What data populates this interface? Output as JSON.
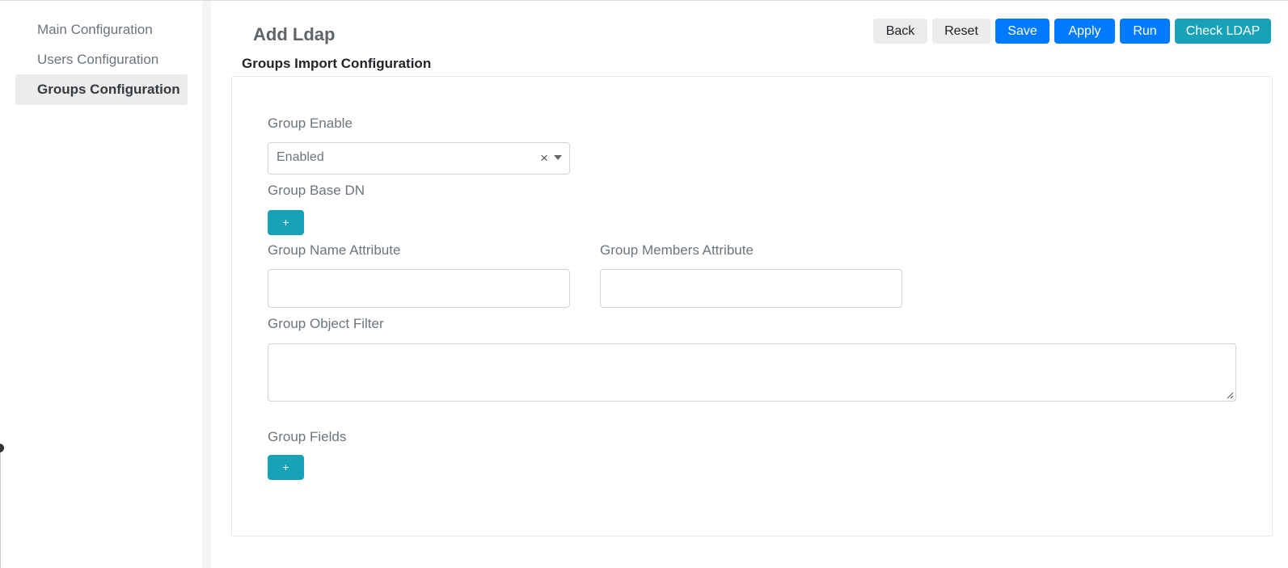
{
  "sidebar": {
    "items": [
      {
        "label": "Main Configuration",
        "active": false
      },
      {
        "label": "Users Configuration",
        "active": false
      },
      {
        "label": "Groups Configuration",
        "active": true
      }
    ]
  },
  "header": {
    "title": "Add Ldap",
    "section_title": "Groups Import Configuration"
  },
  "toolbar": {
    "back_label": "Back",
    "reset_label": "Reset",
    "save_label": "Save",
    "apply_label": "Apply",
    "run_label": "Run",
    "check_ldap_label": "Check LDAP"
  },
  "form": {
    "group_enable": {
      "label": "Group Enable",
      "value": "Enabled",
      "clear_glyph": "×"
    },
    "group_base_dn": {
      "label": "Group Base DN",
      "add_label": "+"
    },
    "group_name_attribute": {
      "label": "Group Name Attribute",
      "value": ""
    },
    "group_members_attribute": {
      "label": "Group Members Attribute",
      "value": ""
    },
    "group_object_filter": {
      "label": "Group Object Filter",
      "value": ""
    },
    "group_fields": {
      "label": "Group Fields",
      "add_label": "+"
    }
  },
  "colors": {
    "primary": "#007bff",
    "info": "#17a2b8",
    "light": "#ececec"
  }
}
